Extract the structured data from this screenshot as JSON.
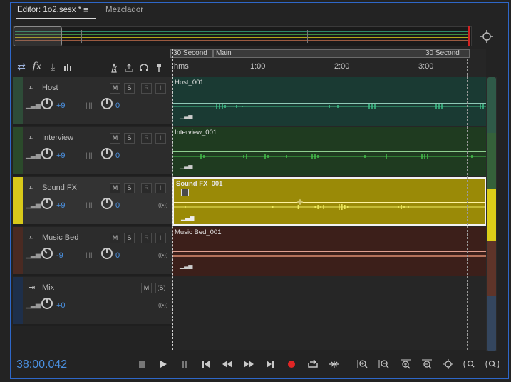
{
  "tabs": {
    "editor": "Editor: 1o2.sesx *",
    "menu": "≡",
    "mixer": "Mezclador"
  },
  "ruler": {
    "markers": [
      {
        "label": "30 Second"
      },
      {
        "label": "Main"
      },
      {
        "label": "30 Second"
      }
    ],
    "units": "hms",
    "ticks": [
      "1:00",
      "2:00",
      "3:00"
    ]
  },
  "toolbar": {
    "fx_label": "fx"
  },
  "tracks": [
    {
      "name": "Host",
      "volume": "+9",
      "pan": "0",
      "color": "#2e4c38",
      "clip": "Host_001",
      "clip_color": "#1a3a33",
      "wave_color": "#3ec08a"
    },
    {
      "name": "Interview",
      "volume": "+9",
      "pan": "0",
      "color": "#2b4a2b",
      "clip": "Interview_001",
      "clip_color": "#1f3b20",
      "wave_color": "#45c24c"
    },
    {
      "name": "Sound FX",
      "volume": "+9",
      "pan": "0",
      "color": "#d8c91a",
      "clip": "Sound FX_001",
      "clip_color": "#9a8a07",
      "wave_color": "#f0ec60"
    },
    {
      "name": "Music Bed",
      "volume": "-9",
      "pan": "0",
      "color": "#4a2a22",
      "clip": "Music Bed_001",
      "clip_color": "#3c1f1a",
      "wave_color": "#d2866a"
    },
    {
      "name": "Mix",
      "volume": "+0",
      "color": "#1e2f4a"
    }
  ],
  "buttons": {
    "mute": "M",
    "solo": "S",
    "record": "R",
    "input": "I",
    "solo_safe": "(S)"
  },
  "transport": {
    "time": "38:00.042"
  }
}
